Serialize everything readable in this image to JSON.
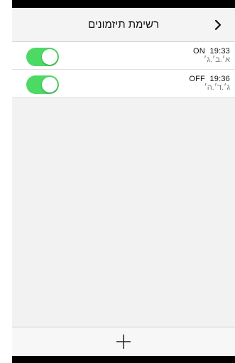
{
  "header": {
    "title": "רשימת תיזמונים",
    "back_icon": "chevron-right-icon"
  },
  "timers": [
    {
      "time": "19:33",
      "state": "ON",
      "days": "א׳.ב׳.ג׳",
      "enabled": true
    },
    {
      "time": "19:36",
      "state": "OFF",
      "days": "ג׳.ד׳.ה׳",
      "enabled": true
    }
  ],
  "footer": {
    "add_icon": "plus-icon"
  },
  "colors": {
    "toggle_on": "#4cd964",
    "background": "#f2f2f2"
  }
}
